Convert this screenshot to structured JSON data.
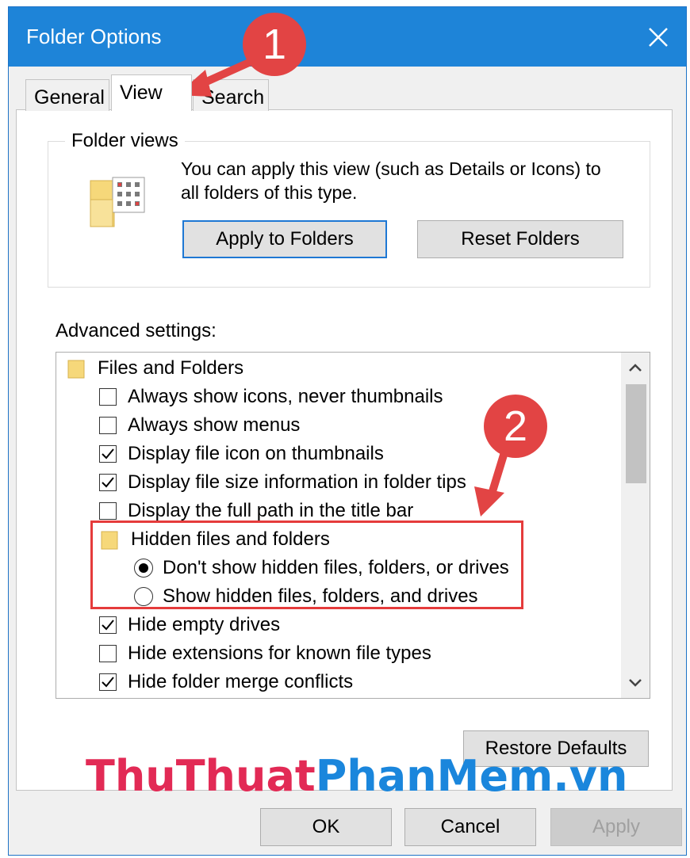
{
  "window": {
    "title": "Folder Options"
  },
  "tabs": [
    {
      "label": "General",
      "active": false
    },
    {
      "label": "View",
      "active": true
    },
    {
      "label": "Search",
      "active": false
    }
  ],
  "folder_views": {
    "legend": "Folder views",
    "description_line1": "You can apply this view (such as Details or Icons) to",
    "description_line2": "all folders of this type.",
    "apply_button": "Apply to Folders",
    "reset_button": "Reset Folders"
  },
  "advanced": {
    "label": "Advanced settings:",
    "items": [
      {
        "type": "folder",
        "label": "Files and Folders"
      },
      {
        "type": "checkbox",
        "label": "Always show icons, never thumbnails",
        "checked": false
      },
      {
        "type": "checkbox",
        "label": "Always show menus",
        "checked": false
      },
      {
        "type": "checkbox",
        "label": "Display file icon on thumbnails",
        "checked": true
      },
      {
        "type": "checkbox",
        "label": "Display file size information in folder tips",
        "checked": true
      },
      {
        "type": "checkbox",
        "label": "Display the full path in the title bar",
        "checked": false
      },
      {
        "type": "folder",
        "label": "Hidden files and folders"
      },
      {
        "type": "radio",
        "label": "Don't show hidden files, folders, or drives",
        "checked": true
      },
      {
        "type": "radio",
        "label": "Show hidden files, folders, and drives",
        "checked": false
      },
      {
        "type": "checkbox",
        "label": "Hide empty drives",
        "checked": true
      },
      {
        "type": "checkbox",
        "label": "Hide extensions for known file types",
        "checked": false
      },
      {
        "type": "checkbox",
        "label": "Hide folder merge conflicts",
        "checked": true
      }
    ]
  },
  "restore_defaults": "Restore Defaults",
  "footer": {
    "ok": "OK",
    "cancel": "Cancel",
    "apply": "Apply"
  },
  "annotations": {
    "step1": "1",
    "step2": "2"
  },
  "watermark": {
    "part1": "ThuThuat",
    "part2": "PhanMem",
    "part3": ".vn"
  },
  "colors": {
    "titlebar": "#1e84d8",
    "annotation_red": "#e24444",
    "watermark_red": "#e22a55",
    "watermark_blue": "#1a86dc"
  },
  "icons": {
    "close": "close-icon",
    "folder": "folder-icon",
    "folder_views": "folder-views-icon",
    "scroll_up": "chevron-up-icon",
    "scroll_down": "chevron-down-icon"
  }
}
